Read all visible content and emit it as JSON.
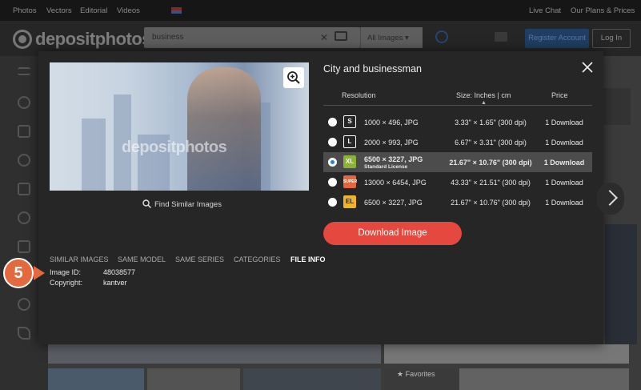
{
  "topbar": {
    "nav": [
      "Photos",
      "Vectors",
      "Editorial",
      "Videos"
    ],
    "live_chat": "Live Chat",
    "plans": "Our Plans & Prices"
  },
  "header": {
    "logo": "depositphotos",
    "search_value": "business",
    "filter": "All Images",
    "register": "Register Account",
    "login": "Log In"
  },
  "modal": {
    "title": "City and businessman",
    "watermark": "depositphotos",
    "find_similar": "Find Similar Images",
    "columns": {
      "resolution": "Resolution",
      "size": "Size: Inches | cm",
      "price": "Price"
    },
    "rows": [
      {
        "badge": "S",
        "resolution": "1000 × 496, JPG",
        "size": "3.33\" × 1.65\" (300 dpi)",
        "price": "1 Download",
        "selected": false
      },
      {
        "badge": "L",
        "resolution": "2000 × 993, JPG",
        "size": "6.67\" × 3.31\" (300 dpi)",
        "price": "1 Download",
        "selected": false
      },
      {
        "badge": "XL",
        "resolution": "6500 × 3227, JPG",
        "license": "Standard License",
        "size": "21.67\" × 10.76\" (300 dpi)",
        "price": "1 Download",
        "selected": true
      },
      {
        "badge": "SUPER",
        "resolution": "13000 × 6454, JPG",
        "size": "43.33\" × 21.51\" (300 dpi)",
        "price": "1 Download",
        "selected": false
      },
      {
        "badge": "EL",
        "resolution": "6500 × 3227, JPG",
        "size": "21.67\" × 10.76\" (300 dpi)",
        "price": "1 Download",
        "selected": false
      }
    ],
    "download_button": "Download Image",
    "tabs": [
      "SIMILAR IMAGES",
      "SAME MODEL",
      "SAME SERIES",
      "CATEGORIES",
      "FILE INFO"
    ],
    "active_tab": "FILE INFO",
    "file_info": {
      "image_id_label": "Image ID:",
      "image_id": "48038577",
      "copyright_label": "Copyright:",
      "copyright": "kantver"
    }
  },
  "annotation": {
    "step": "5"
  },
  "background": {
    "favorites": "Favorites"
  },
  "colors": {
    "download": "#e5483f",
    "selected_row": "#4c4c4c",
    "marker": "#e36a3f",
    "xl_badge": "#8bb135"
  }
}
